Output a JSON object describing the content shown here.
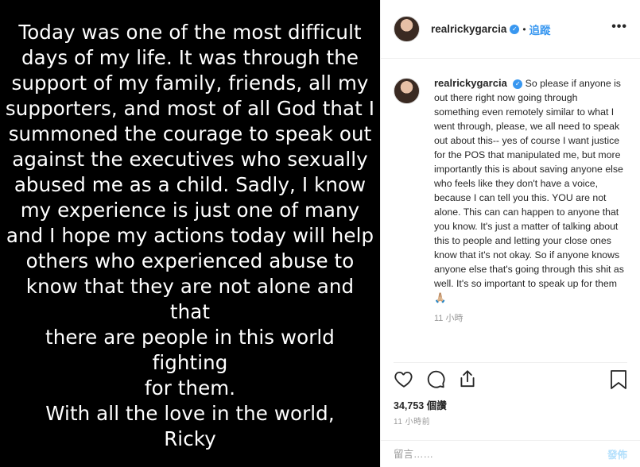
{
  "image_post": {
    "message": "Today was one of the most difficult\ndays of my life. It was through the\nsupport of my family, friends, all my\nsupporters, and most of all God that I\nsummoned the courage to speak out\nagainst the executives who sexually\nabused me as a child. Sadly, I know\nmy experience is just one of many\nand I hope my actions today will help\nothers who experienced abuse to\nknow that they are not alone and that\nthere are people in this world fighting\nfor them.\nWith all the love in the world,\nRicky"
  },
  "header": {
    "username": "realrickygarcia",
    "separator": "•",
    "follow_label": "追蹤",
    "more": "•••"
  },
  "caption": {
    "username": "realrickygarcia",
    "text": "So please if anyone is out there right now going through something even remotely similar to what I went through, please, we all need to speak out about this-- yes of course I want justice for the POS that manipulated me, but more importantly this is about saving anyone else who feels like they don't have a voice, because I can tell you this. YOU are not alone. This can can happen to anyone that you know. It's just a matter of talking about this to people and letting your close ones know that it's not okay. So if anyone knows anyone else that's going through this shit as well. It's so important to speak up for them🙏🏼",
    "time": "11 小時"
  },
  "stats": {
    "likes": "34,753 個讚",
    "posted": "11 小時前"
  },
  "comment_box": {
    "placeholder": "留言……",
    "post_label": "發佈"
  },
  "colors": {
    "accent": "#3897f0",
    "post_disabled": "#b2dffc"
  },
  "icons": [
    "heart-icon",
    "comment-icon",
    "share-icon",
    "bookmark-icon",
    "verified-icon"
  ]
}
